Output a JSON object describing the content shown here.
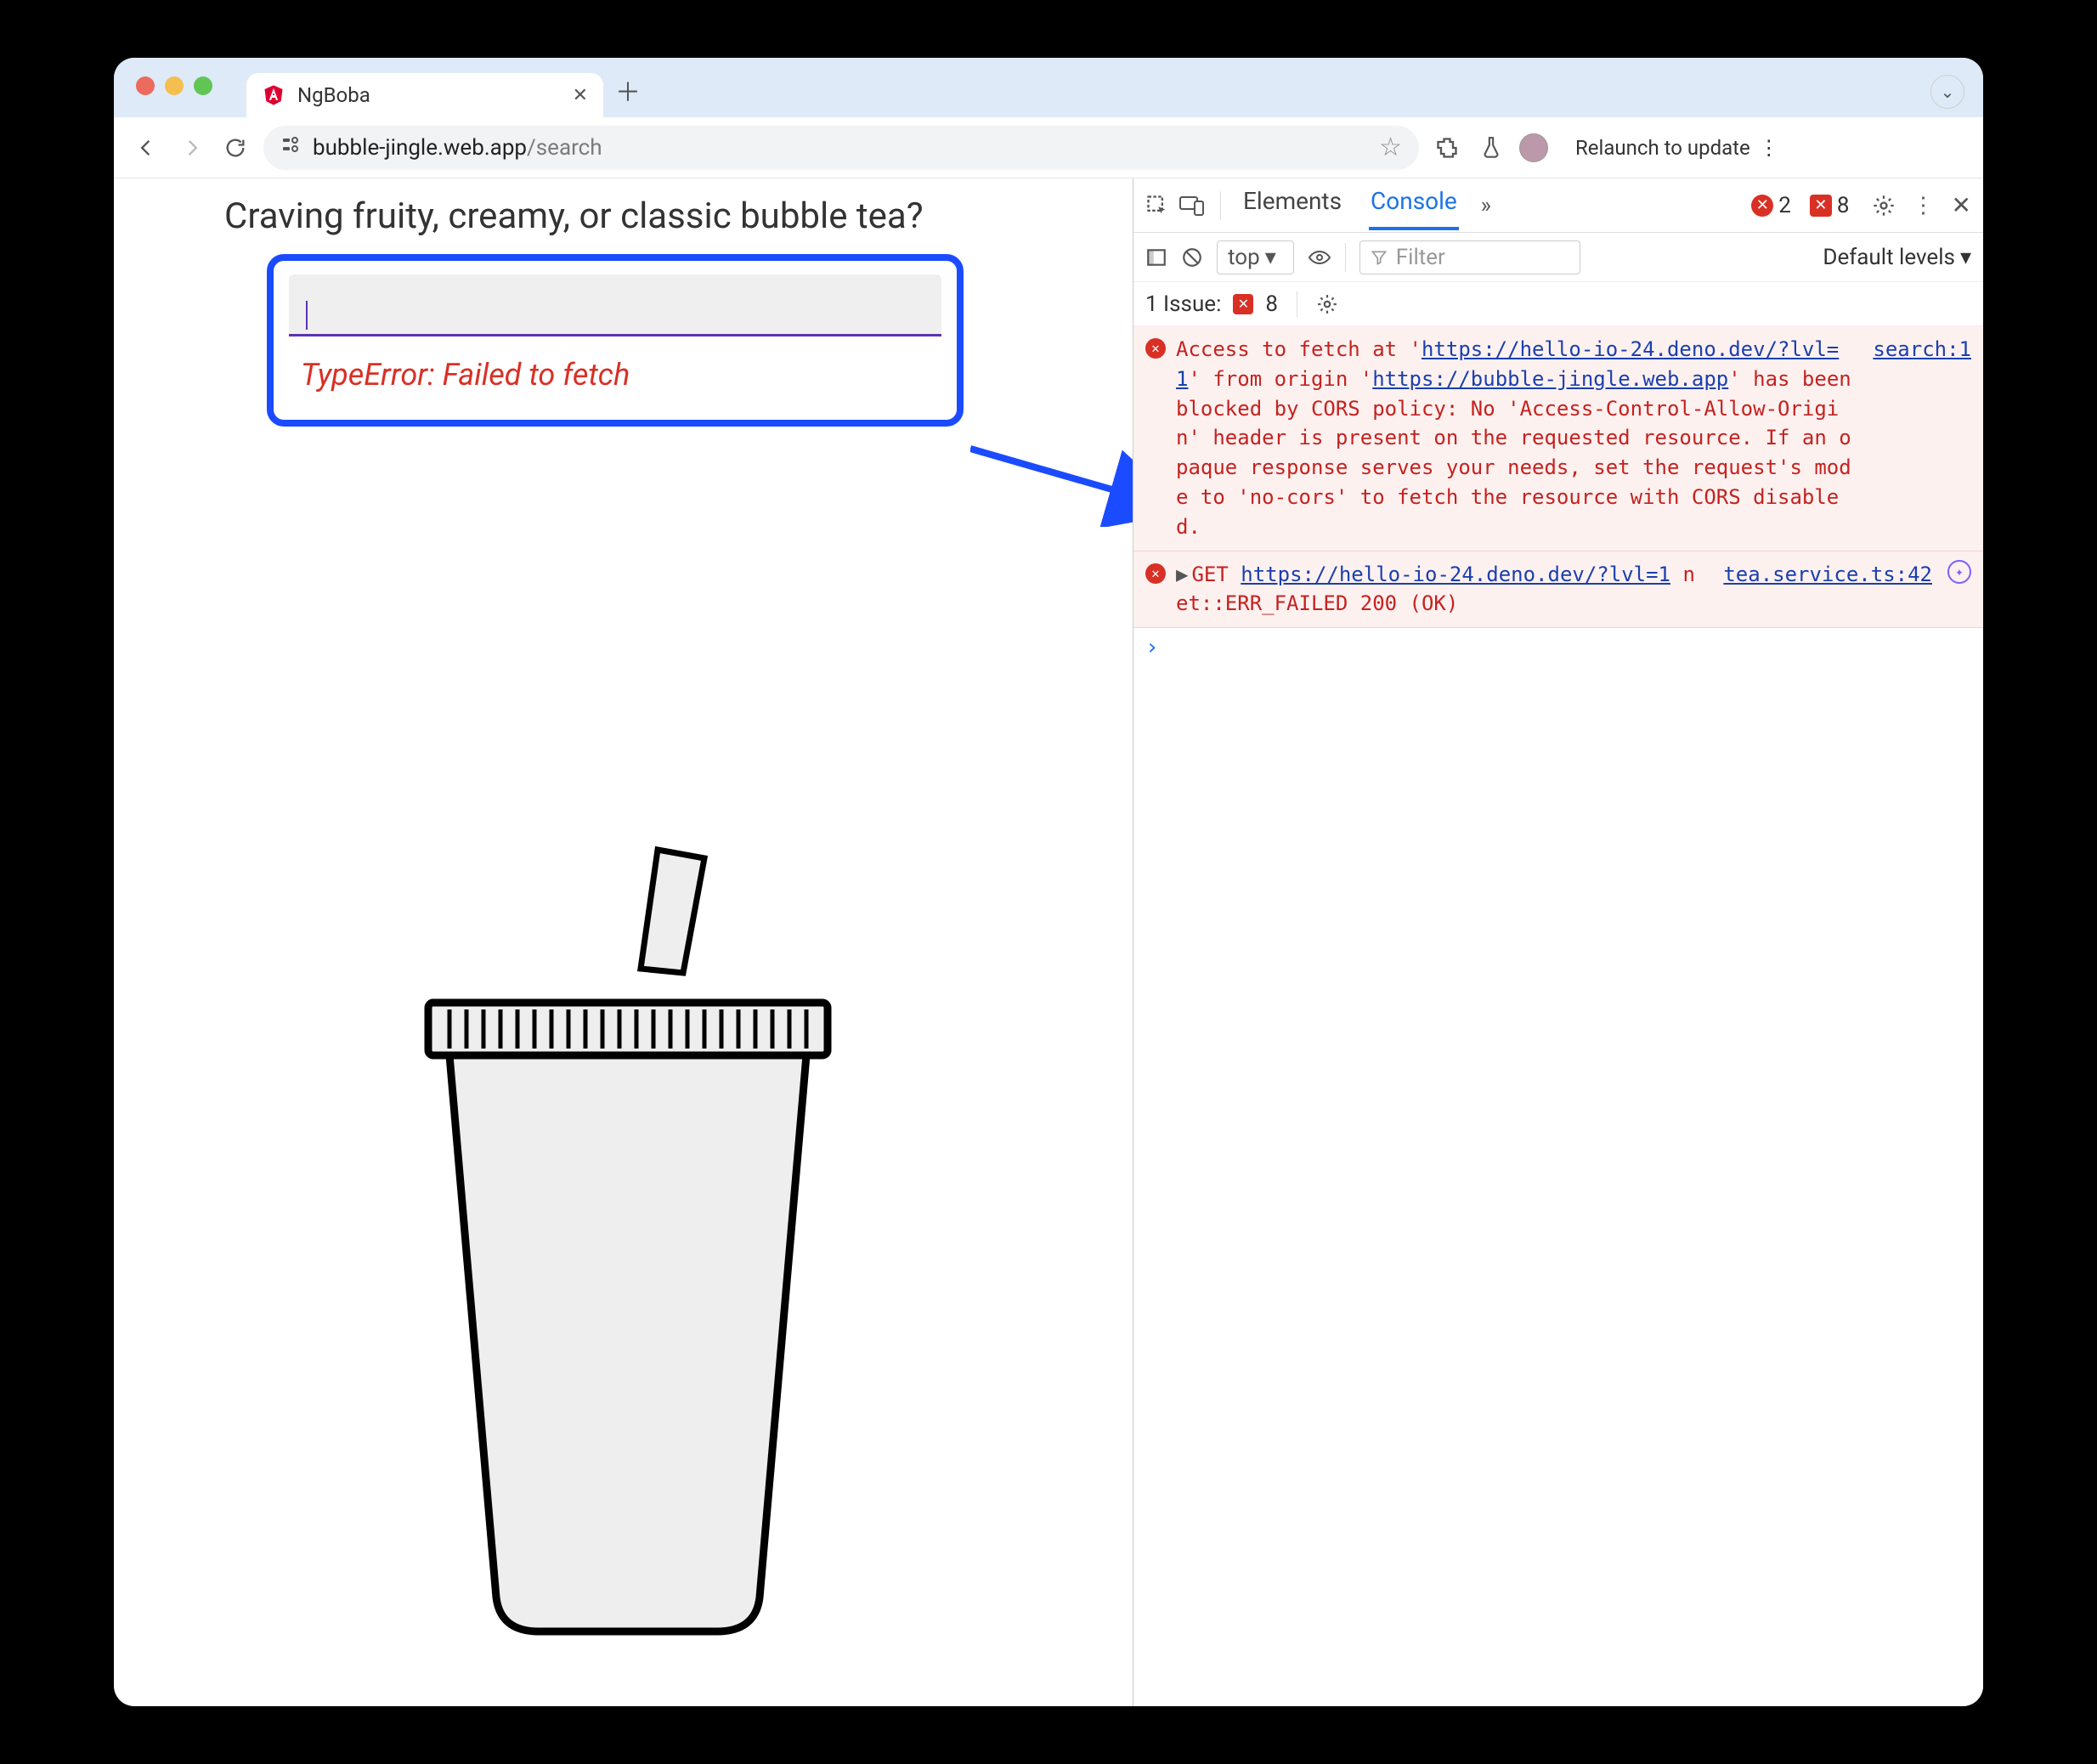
{
  "browser": {
    "tab_title": "NgBoba",
    "url_domain": "bubble-jingle.web.app",
    "url_path": "/search",
    "update_label": "Relaunch to update"
  },
  "page": {
    "heading": "Craving fruity, creamy, or classic bubble tea?",
    "input_value": "",
    "error_text": "TypeError: Failed to fetch"
  },
  "devtools": {
    "tabs": {
      "elements": "Elements",
      "console": "Console"
    },
    "error_count": "2",
    "warning_count": "8",
    "context_label": "top",
    "filter_placeholder": "Filter",
    "levels_label": "Default levels",
    "issues_label": "1 Issue:",
    "issues_count": "8",
    "messages": [
      {
        "source": "search:1",
        "pre": "Access to fetch at '",
        "link1": "https://hello-io-24.deno.dev/?lvl=1",
        "mid1": "' from origin '",
        "link2": "https://bubble-jingle.web.app",
        "post": "' has been blocked by CORS policy: No 'Access-Control-Allow-Origin' header is present on the requested resource. If an opaque response serves your needs, set the request's mode to 'no-cors' to fetch the resource with CORS disabled."
      },
      {
        "source": "tea.service.ts:42",
        "verb": "GET",
        "link": "https://hello-io-24.deno.dev/?lvl=1",
        "tail": " net::ERR_FAILED 200 (OK)"
      }
    ]
  }
}
